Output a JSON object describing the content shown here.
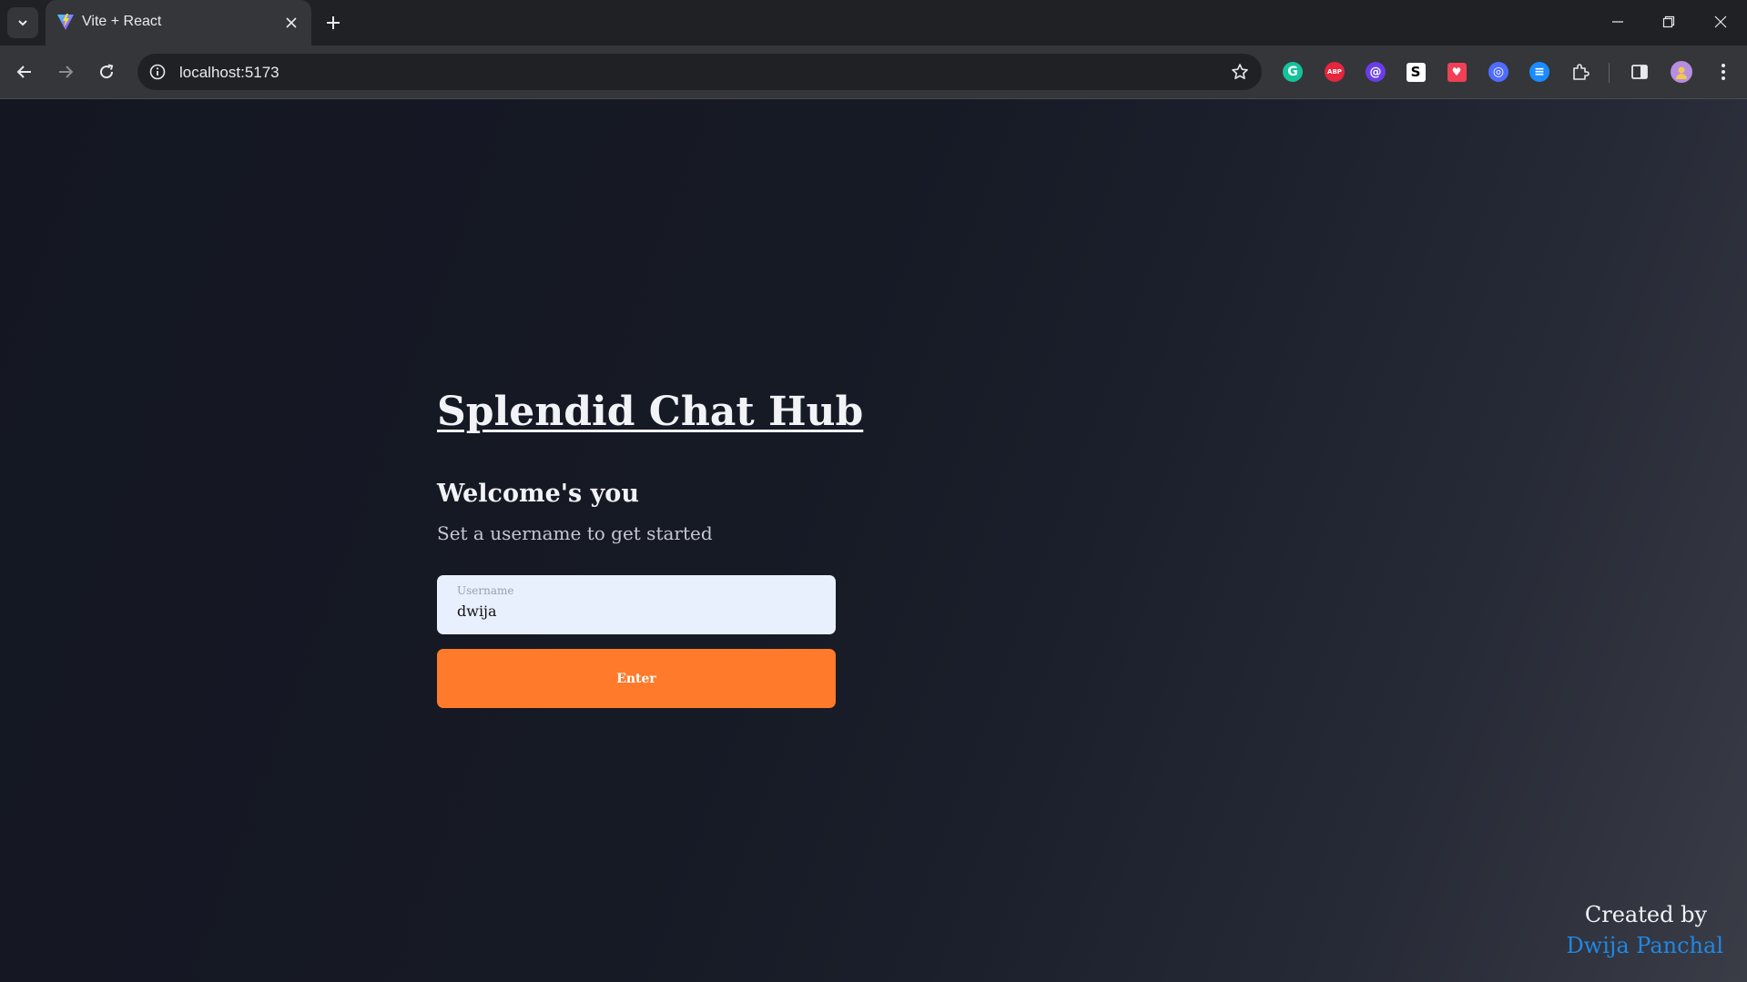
{
  "browser": {
    "tab": {
      "title": "Vite + React",
      "favicon": "vite-logo-icon"
    },
    "address_bar": {
      "url": "localhost:5173"
    },
    "extensions": [
      {
        "name": "grammarly-icon",
        "color": "#15c39a",
        "glyph": "G"
      },
      {
        "name": "adblock-plus-icon",
        "color": "#e5263d",
        "glyph": "ABP"
      },
      {
        "name": "extension-w-icon",
        "color": "#6a3de8",
        "glyph": "@"
      },
      {
        "name": "extension-s-icon",
        "color": "#ffffff",
        "glyph": "S"
      },
      {
        "name": "pocket-icon",
        "color": "#ef4056",
        "glyph": "♥"
      },
      {
        "name": "extension-swirl-icon",
        "color": "#4f6cff",
        "glyph": "◎"
      },
      {
        "name": "extension-list-icon",
        "color": "#1a8cff",
        "glyph": "≡"
      }
    ]
  },
  "app": {
    "title": "Splendid Chat Hub",
    "welcome_heading": "Welcome's you",
    "subtitle": "Set a username to get started",
    "username_field": {
      "label": "Username",
      "value": "dwija"
    },
    "enter_button": "Enter",
    "footer": {
      "created_by": "Created by",
      "author": "Dwija Panchal"
    },
    "colors": {
      "accent": "#ff7a2a",
      "link": "#1f88e5",
      "input_bg": "#e8f0fe"
    }
  }
}
